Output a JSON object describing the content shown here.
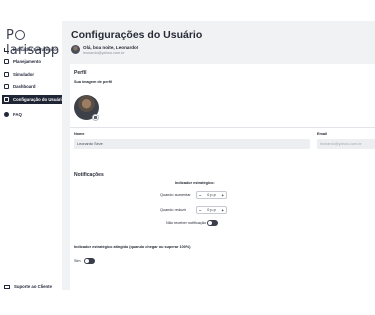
{
  "app": {
    "logo_text": [
      "P",
      "larisapp"
    ]
  },
  "sidebar": {
    "items": [
      {
        "label": "Indicador Estratégico",
        "icon": "bar-chart-icon"
      },
      {
        "label": "Planejamento",
        "icon": "edit-icon"
      },
      {
        "label": "Simulador",
        "icon": "calculator-icon"
      },
      {
        "label": "Dashboard",
        "icon": "dashboard-icon"
      },
      {
        "label": "Configuração do Usuário",
        "icon": "user-settings-icon",
        "active": true
      },
      {
        "label": "FAQ",
        "icon": "help-icon"
      }
    ],
    "footer": {
      "label": "Suporte ao Cliente",
      "icon": "support-icon"
    }
  },
  "header": {
    "title": "Configurações do Usuário",
    "greeting": "Olá, boa noite, Leonardo!",
    "email": "leonardo@yahoo.com.br"
  },
  "profile": {
    "title": "Perfil",
    "image_label": "Sua imagem de perfil",
    "name_label": "Nome",
    "name_value": "Leonardo Seve",
    "email_label": "Email",
    "email_value": "leonardo@yahoo.com.br"
  },
  "notifications": {
    "title": "Notificações",
    "subtitle": "Indicador estratégico:",
    "increase_label": "Quando aumentar",
    "increase_value": "0 p.p",
    "decrease_label": "Quando reduzir",
    "decrease_value": "0 p.p",
    "minus": "−",
    "plus": "+",
    "no_notify_label": "Não receber notificação",
    "target_label": "Indicador estratégico atingido (quando chegar ou superar 100%)",
    "yes_no_label": "Sim"
  },
  "colors": {
    "active_nav": "#1f2534",
    "panel_bg": "#f1f2f4"
  }
}
